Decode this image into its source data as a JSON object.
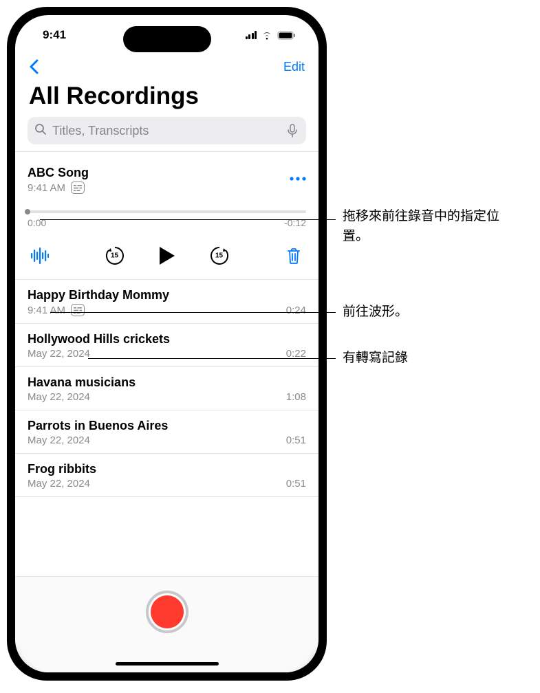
{
  "status": {
    "time": "9:41"
  },
  "nav": {
    "edit": "Edit"
  },
  "page_title": "All Recordings",
  "search": {
    "placeholder": "Titles, Transcripts"
  },
  "expanded": {
    "title": "ABC Song",
    "subtitle": "9:41 AM",
    "start_time": "0:00",
    "end_time": "-0:12",
    "skip_back": "15",
    "skip_fwd": "15"
  },
  "recordings": [
    {
      "title": "Happy Birthday Mommy",
      "subtitle": "9:41 AM",
      "duration": "0:24",
      "has_transcript": true
    },
    {
      "title": "Hollywood Hills crickets",
      "subtitle": "May 22, 2024",
      "duration": "0:22",
      "has_transcript": false
    },
    {
      "title": "Havana musicians",
      "subtitle": "May 22, 2024",
      "duration": "1:08",
      "has_transcript": false
    },
    {
      "title": "Parrots in Buenos Aires",
      "subtitle": "May 22, 2024",
      "duration": "0:51",
      "has_transcript": false
    },
    {
      "title": "Frog ribbits",
      "subtitle": "May 22, 2024",
      "duration": "0:51",
      "has_transcript": false
    }
  ],
  "callouts": {
    "scrubber": "拖移來前往錄音中的指定位置。",
    "waveform": "前往波形。",
    "transcript": "有轉寫記錄"
  }
}
